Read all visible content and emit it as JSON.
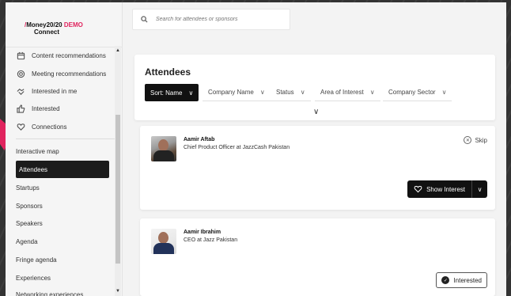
{
  "brand": {
    "line1": "Money20/20",
    "demo": "DEMO",
    "line2": "Connect",
    "accent_color": "#e0245e"
  },
  "search": {
    "placeholder": "Search for attendees or sponsors",
    "icon": "search-icon"
  },
  "sidebar": {
    "sub_items": [
      {
        "label": "Content recommendations",
        "icon": "calendar-check-icon"
      },
      {
        "label": "Meeting recommendations",
        "icon": "target-icon"
      },
      {
        "label": "Interested in me",
        "icon": "handshake-icon"
      },
      {
        "label": "Interested",
        "icon": "thumbs-up-icon"
      },
      {
        "label": "Connections",
        "icon": "handshake-heart-icon"
      }
    ],
    "nav_items": [
      {
        "label": "Interactive map"
      },
      {
        "label": "Attendees"
      },
      {
        "label": "Startups"
      },
      {
        "label": "Sponsors"
      },
      {
        "label": "Speakers"
      },
      {
        "label": "Agenda"
      },
      {
        "label": "Fringe agenda"
      },
      {
        "label": "Experiences"
      },
      {
        "label": "Networking experiences"
      }
    ],
    "active_item": "Attendees"
  },
  "main": {
    "title": "Attendees",
    "filters": [
      {
        "label": "Sort: Name"
      },
      {
        "label": "Company Name"
      },
      {
        "label": "Status"
      },
      {
        "label": "Area of Interest"
      },
      {
        "label": "Company Sector"
      }
    ]
  },
  "attendees": [
    {
      "name": "Aamir Aftab",
      "role": "Chief Product Officer at JazzCash Pakistan",
      "skip_label": "Skip",
      "action_label": "Show Interest"
    },
    {
      "name": "Aamir Ibrahim",
      "role": "CEO at Jazz Pakistan",
      "action_label": "Interested"
    }
  ]
}
